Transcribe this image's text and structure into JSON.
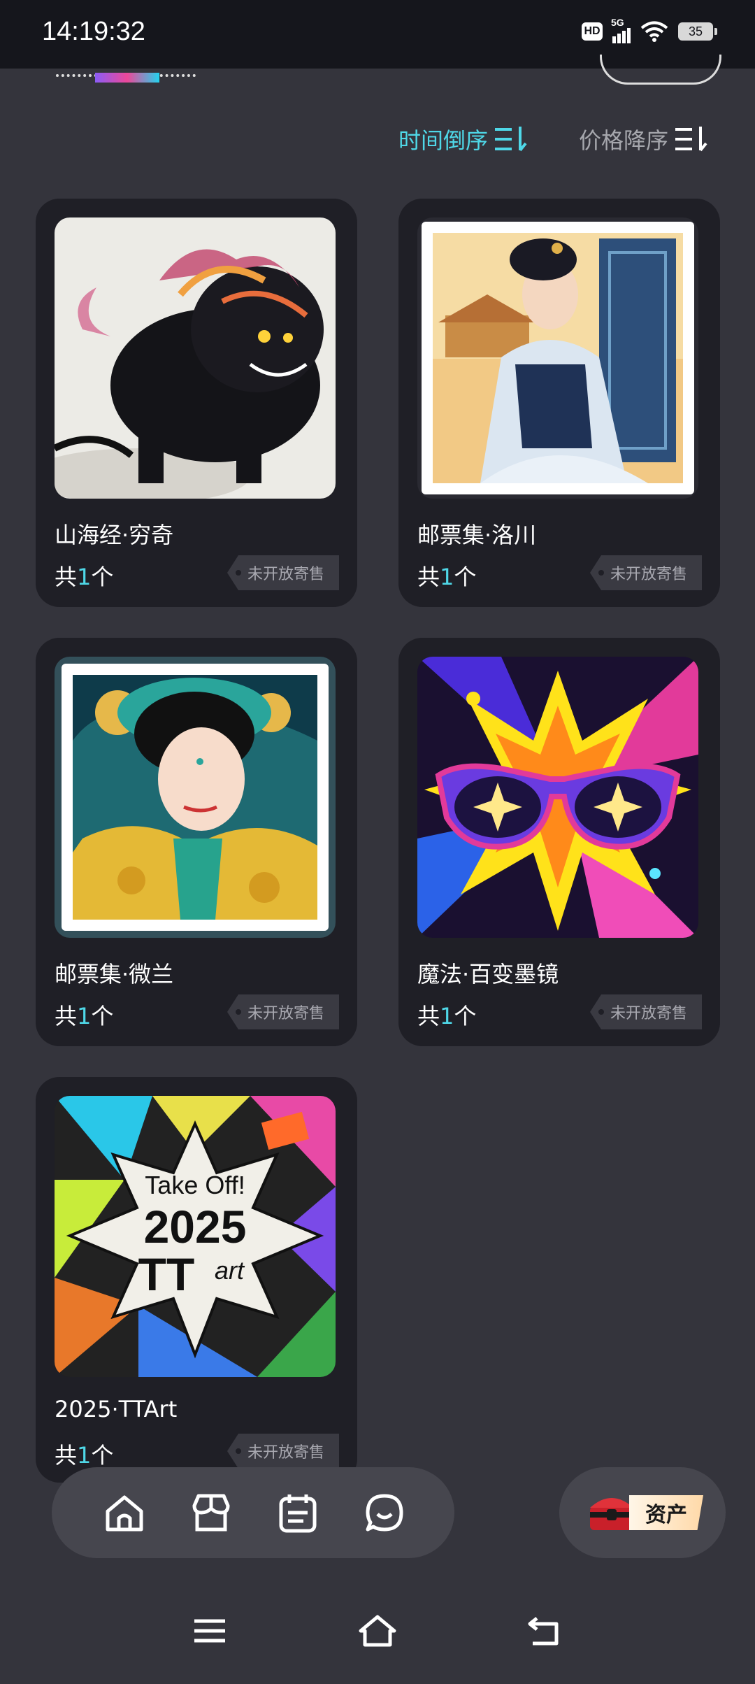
{
  "status_bar": {
    "time": "14:19:32",
    "hd": "HD",
    "network": "5G",
    "battery": "35"
  },
  "sort": {
    "time_label": "时间倒序",
    "price_label": "价格降序",
    "active": "time",
    "active_color": "#4fd8e8"
  },
  "cards": [
    {
      "title": "山海经·穷奇",
      "count_prefix": "共",
      "count": "1",
      "count_suffix": "个",
      "tag": "未开放寄售",
      "image": "black-qiongqi-beast-ink-painting"
    },
    {
      "title": "邮票集·洛川",
      "count_prefix": "共",
      "count": "1",
      "count_suffix": "个",
      "tag": "未开放寄售",
      "image": "stamp-tang-lady-palace"
    },
    {
      "title": "邮票集·微兰",
      "count_prefix": "共",
      "count": "1",
      "count_suffix": "个",
      "tag": "未开放寄售",
      "image": "stamp-lady-yellow-robe"
    },
    {
      "title": "魔法·百变墨镜",
      "count_prefix": "共",
      "count": "1",
      "count_suffix": "个",
      "tag": "未开放寄售",
      "image": "pop-art-star-sunglasses"
    },
    {
      "title": "2025·TTArt",
      "count_prefix": "共",
      "count": "1",
      "count_suffix": "个",
      "tag": "未开放寄售",
      "image": "take-off-2025-ttart-poster"
    }
  ],
  "poster_text": {
    "line1": "Take Off!",
    "line2": "2025",
    "line3": "TT",
    "line3b": "art"
  },
  "bottom_nav": {
    "items": [
      "home-icon",
      "store-icon",
      "calendar-icon",
      "chat-icon"
    ],
    "asset_label": "资产"
  },
  "system_nav": [
    "menu-icon",
    "home-outline-icon",
    "back-icon"
  ]
}
